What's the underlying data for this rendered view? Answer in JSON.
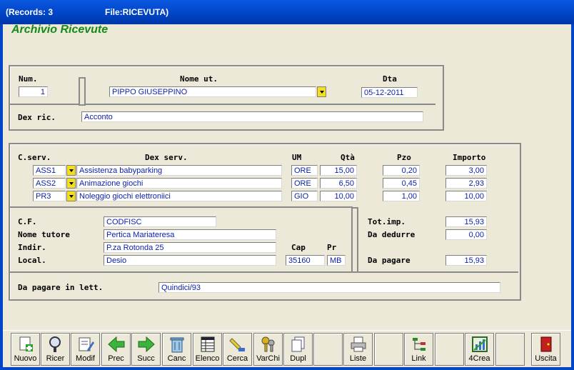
{
  "window": {
    "records": "(Records: 3",
    "file": "File:RICEVUTA)"
  },
  "app_title": "Archivio Ricevute",
  "header": {
    "num_label": "Num.",
    "num": "1",
    "nome_label": "Nome ut.",
    "nome": "PIPPO GIUSEPPINO",
    "dta_label": "Dta",
    "dta": "05-12-2011",
    "dex_label": "Dex ric.",
    "dex": "Acconto"
  },
  "lines": {
    "headers": {
      "cserv": "C.serv.",
      "dex": "Dex serv.",
      "um": "UM",
      "qta": "Qtà",
      "pzo": "Pzo",
      "importo": "Importo"
    },
    "rows": [
      {
        "code": "ASS1",
        "desc": "Assistenza babyparking",
        "um": "ORE",
        "qta": "15,00",
        "pzo": "0,20",
        "importo": "3,00"
      },
      {
        "code": "ASS2",
        "desc": "Animazione giochi",
        "um": "ORE",
        "qta": "6,50",
        "pzo": "0,45",
        "importo": "2,93"
      },
      {
        "code": "PR3",
        "desc": "Noleggio giochi elettroniici",
        "um": "GIO",
        "qta": "10,00",
        "pzo": "1,00",
        "importo": "10,00"
      }
    ]
  },
  "client": {
    "cf_label": "C.F.",
    "cf": "CODFISC",
    "tutore_label": "Nome tutore",
    "tutore": "Pertica Mariateresa",
    "indir_label": "Indir.",
    "indir": "P.za Rotonda 25",
    "local_label": "Local.",
    "local": "Desio",
    "cap_label": "Cap",
    "cap": "35160",
    "pr_label": "Pr",
    "pr": "MB"
  },
  "totals": {
    "totimp_label": "Tot.imp.",
    "totimp": "15,93",
    "dedurre_label": "Da dedurre",
    "dedurre": "0,00",
    "pagare_label": "Da pagare",
    "pagare": "15,93"
  },
  "lett": {
    "label": "Da pagare in lett.",
    "value": "Quindici/93"
  },
  "toolbar": {
    "nuovo": "Nuovo",
    "ricer": "Ricer",
    "modif": "Modif",
    "prec": "Prec",
    "succ": "Succ",
    "canc": "Canc",
    "elenco": "Elenco",
    "cerca": "Cerca",
    "varchi": "VarChi",
    "dupl": "Dupl",
    "liste": "Liste",
    "link": "Link",
    "crea": "4Crea",
    "uscita": "Uscita"
  },
  "colors": {
    "title_bar": "#0045c8",
    "app_title": "#158a15",
    "dropdown": "#f3e01a",
    "field_text": "#0a1fa8"
  }
}
